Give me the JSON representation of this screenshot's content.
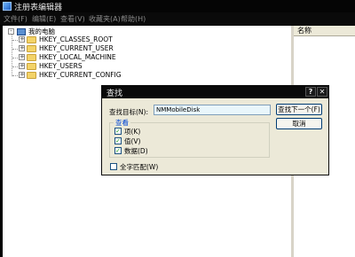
{
  "window": {
    "title": "注册表编辑器",
    "icon": "regedit-icon"
  },
  "menu": [
    {
      "label": "文件(F)"
    },
    {
      "label": "编辑(E)"
    },
    {
      "label": "查看(V)"
    },
    {
      "label": "收藏夹(A)"
    },
    {
      "label": "帮助(H)"
    }
  ],
  "tree": {
    "root": {
      "label": "我的电脑",
      "expander": "-",
      "icon": "computer-icon"
    },
    "children": [
      {
        "label": "HKEY_CLASSES_ROOT",
        "expander": "+",
        "icon": "folder-icon"
      },
      {
        "label": "HKEY_CURRENT_USER",
        "expander": "+",
        "icon": "folder-icon"
      },
      {
        "label": "HKEY_LOCAL_MACHINE",
        "expander": "+",
        "icon": "folder-icon"
      },
      {
        "label": "HKEY_USERS",
        "expander": "+",
        "icon": "folder-icon"
      },
      {
        "label": "HKEY_CURRENT_CONFIG",
        "expander": "+",
        "icon": "folder-icon"
      }
    ]
  },
  "list": {
    "column_name": "名称"
  },
  "find_dialog": {
    "title": "查找",
    "help_button": "?",
    "close_button": "✕",
    "target_label": "查找目标(N):",
    "target_value": "NMMobileDisk",
    "find_next_label": "查找下一个(F)",
    "cancel_label": "取消",
    "group_label": "查看",
    "options": [
      {
        "label": "项(K)",
        "checked": true
      },
      {
        "label": "值(V)",
        "checked": true
      },
      {
        "label": "数据(D)",
        "checked": true
      }
    ],
    "match_whole": {
      "label": "全字匹配(W)",
      "checked": false
    }
  }
}
